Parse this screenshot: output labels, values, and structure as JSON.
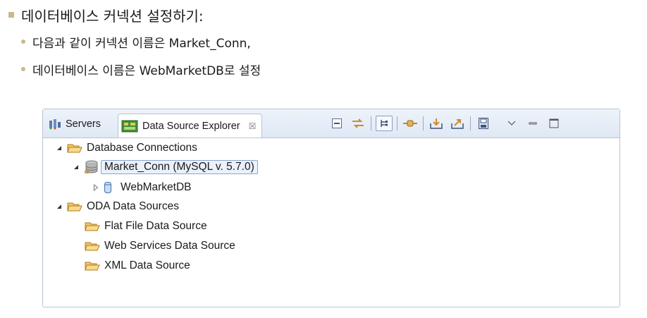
{
  "bullets": {
    "main": "데이터베이스 커넥션 설정하기:",
    "sub1": "다음과 같이 커넥션 이름은 Market_Conn,",
    "sub2": "데이터베이스 이름은 WebMarketDB로 설정"
  },
  "tabs": {
    "servers": "Servers",
    "data_source_explorer": "Data Source Explorer",
    "close_glyph": "☒"
  },
  "tree": {
    "database_connections": "Database Connections",
    "market_conn": "Market_Conn (MySQL v. 5.7.0)",
    "webmarketdb": "WebMarketDB",
    "oda_data_sources": "ODA Data Sources",
    "flat_file": "Flat File Data Source",
    "web_services": "Web Services Data Source",
    "xml": "XML Data Source"
  },
  "colors": {
    "bullet": "#c9b98a",
    "folder": "#e8a23a",
    "tabbar": "#dfe8f5",
    "selection_border": "#8aa6cf"
  }
}
